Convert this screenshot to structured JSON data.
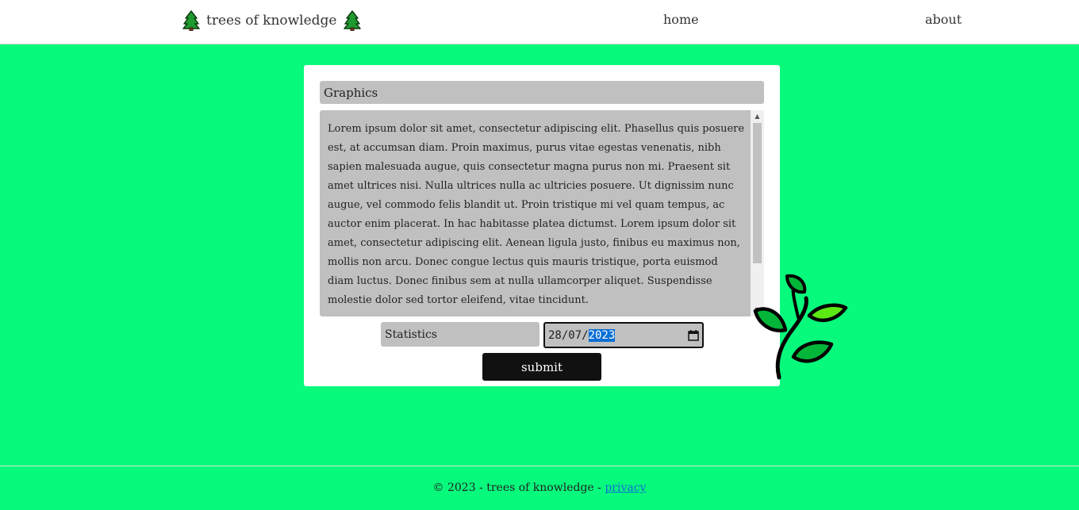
{
  "header": {
    "brand": "trees of knowledge",
    "nav": {
      "home": "home",
      "about": "about"
    }
  },
  "form": {
    "title_value": "Graphics",
    "body_value": "Lorem ipsum dolor sit amet, consectetur adipiscing elit. Phasellus quis posuere est, at accumsan diam. Proin maximus, purus vitae egestas venenatis, nibh sapien malesuada augue, quis consectetur magna purus non mi. Praesent sit amet ultrices nisi. Nulla ultrices nulla ac ultricies posuere. Ut dignissim nunc augue, vel commodo felis blandit ut. Proin tristique mi vel quam tempus, ac auctor enim placerat. In hac habitasse platea dictumst. Lorem ipsum dolor sit amet, consectetur adipiscing elit. Aenean ligula justo, finibus eu maximus non, mollis non arcu. Donec congue lectus quis mauris tristique, porta euismod diam luctus. Donec finibus sem at nulla ullamcorper aliquet. Suspendisse molestie dolor sed tortor eleifend, vitae tincidunt.",
    "category_value": "Statistics",
    "date_day_month": "28/07/",
    "date_year": "2023",
    "submit_label": "submit"
  },
  "footer": {
    "text": "© 2023 - trees of knowledge - ",
    "privacy": "privacy"
  },
  "colors": {
    "background": "#07fa7c",
    "field": "#c0c0c0",
    "button": "#111111",
    "link": "#0a6fd6"
  },
  "icons": [
    "tree-icon",
    "calendar-icon",
    "scroll-up-icon",
    "scroll-down-icon",
    "leaf-illustration"
  ]
}
